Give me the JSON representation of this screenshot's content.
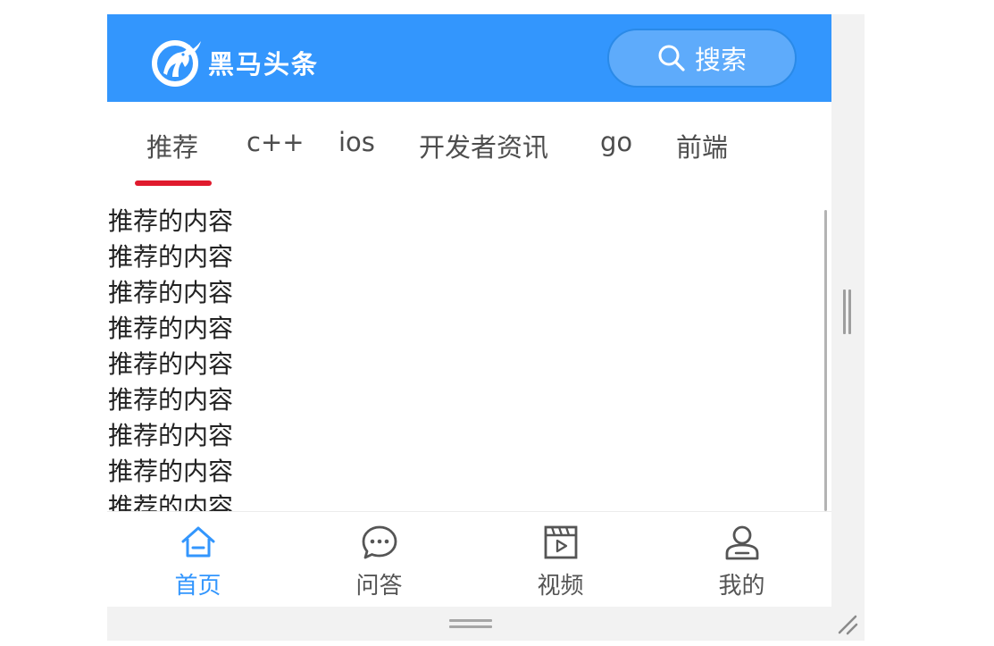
{
  "colors": {
    "navbar": "#3396fd",
    "search_button": "#5eabfb",
    "active_tab_indicator": "#e01a2d",
    "active_bottom_tab": "#3396fd",
    "inactive_text": "#555555"
  },
  "header": {
    "logo_icon": "horse-logo-icon",
    "title": "黑马头条",
    "search": {
      "icon": "search-icon",
      "label": "搜索"
    }
  },
  "channels": [
    {
      "label": "推荐",
      "active": true
    },
    {
      "label": "c++",
      "active": false
    },
    {
      "label": "ios",
      "active": false
    },
    {
      "label": "开发者资讯",
      "active": false
    },
    {
      "label": "go",
      "active": false
    },
    {
      "label": "前端",
      "active": false
    }
  ],
  "content": {
    "items": [
      "推荐的内容",
      "推荐的内容",
      "推荐的内容",
      "推荐的内容",
      "推荐的内容",
      "推荐的内容",
      "推荐的内容",
      "推荐的内容",
      "推荐的内容"
    ]
  },
  "tabbar": {
    "items": [
      {
        "label": "首页",
        "icon": "home-icon",
        "active": true
      },
      {
        "label": "问答",
        "icon": "chat-bubble-icon",
        "active": false
      },
      {
        "label": "视频",
        "icon": "video-icon",
        "active": false
      },
      {
        "label": "我的",
        "icon": "user-icon",
        "active": false
      }
    ]
  }
}
